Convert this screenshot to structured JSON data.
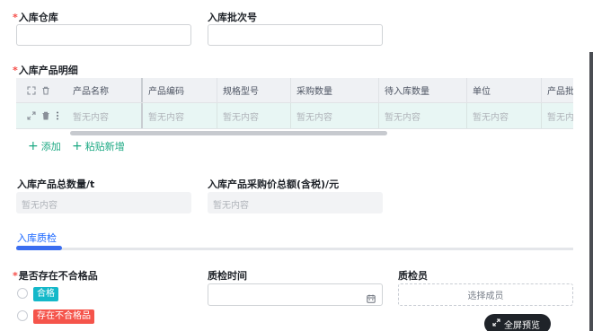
{
  "form": {
    "warehouse_label": "入库仓库",
    "batch_label": "入库批次号",
    "details_label": "入库产品明细",
    "total_qty_label": "入库产品总数量/t",
    "total_qty_value": "暂无内容",
    "total_price_label": "入库产品采购价总额(含税)/元",
    "total_price_value": "暂无内容"
  },
  "table": {
    "columns": [
      "产品名称",
      "产品编码",
      "规格型号",
      "采购数量",
      "待入库数量",
      "单位",
      "产品批"
    ],
    "row": [
      "暂无内容",
      "暂无内容",
      "暂无内容",
      "暂无内容",
      "暂无内容",
      "暂无内容",
      "暂无内容"
    ]
  },
  "actions": {
    "add_label": "添加",
    "paste_label": "粘贴新增"
  },
  "tabs": {
    "active_label": "入库质检"
  },
  "quality": {
    "unqualified_label": "是否存在不合格品",
    "option_qualified": "合格",
    "option_unqualified": "存在不合格品",
    "time_label": "质检时间",
    "inspector_label": "质检员",
    "inspector_placeholder": "选择成员"
  },
  "fullscreen_label": "全屏预览",
  "colors": {
    "accent_green": "#1aa882",
    "tag_teal": "#14b8c9",
    "tag_red": "#f5544b",
    "tab_blue": "#3a6df0",
    "required_red": "#f54a45"
  }
}
